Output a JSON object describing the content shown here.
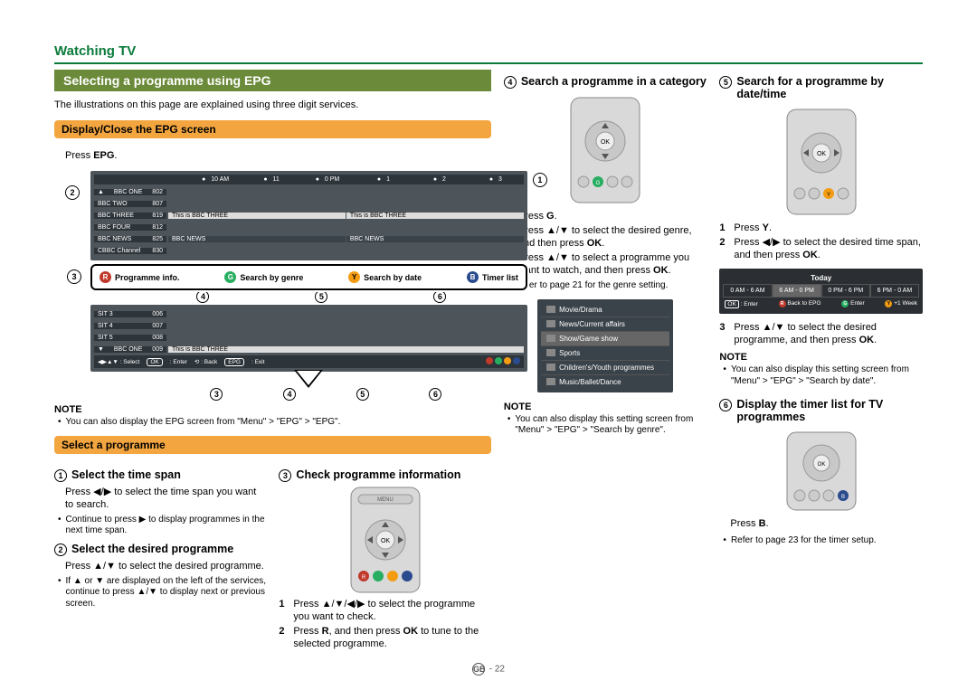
{
  "header": {
    "title": "Watching TV"
  },
  "main": {
    "section_title": "Selecting a programme using EPG",
    "intro": "The illustrations on this page are explained using three digit services."
  },
  "orange1": "Display/Close the EPG screen",
  "orange2": "Select a programme",
  "press_epg": "Press ",
  "press_epg_bold": "EPG",
  "note_label": "NOTE",
  "note_epg_menu": "You can also display the EPG screen from \"Menu\" > \"EPG\" > \"EPG\".",
  "epg": {
    "timeline": [
      "",
      "10 AM",
      "11",
      "0 PM",
      "1",
      "2",
      "3"
    ],
    "channels": [
      {
        "name": "BBC ONE",
        "num": "802",
        "prog": ""
      },
      {
        "name": "BBC TWO",
        "num": "807",
        "prog": ""
      },
      {
        "name": "BBC THREE",
        "num": "819",
        "prog1": "This is BBC THREE",
        "prog2": "This is BBC THREE"
      },
      {
        "name": "BBC FOUR",
        "num": "812",
        "prog": ""
      },
      {
        "name": "BBC NEWS",
        "num": "825",
        "prog1": "BBC NEWS",
        "prog2": "BBC NEWS"
      },
      {
        "name": "CBBC Channel",
        "num": "830",
        "prog": ""
      }
    ],
    "channels2": [
      {
        "name": "SIT 3",
        "num": "006"
      },
      {
        "name": "SIT 4",
        "num": "007"
      },
      {
        "name": "SIT 5",
        "num": "008"
      },
      {
        "name": "BBC ONE",
        "num": "009",
        "prog": "This is BBC THREE"
      }
    ],
    "footer": {
      "select": ": Select",
      "ok": "OK",
      "enter": ": Enter",
      "back": ": Back",
      "epg": "EPG",
      "exit": ": Exit"
    }
  },
  "colorbar": {
    "r": "Programme info.",
    "g": "Search by genre",
    "y": "Search by date",
    "b": "Timer list"
  },
  "step1": {
    "title": "Select the time span",
    "body": "Press ◀/▶ to select the time span you want to search.",
    "bullet": "Continue to press ▶ to display programmes in the next time span."
  },
  "step2": {
    "title": "Select the desired programme",
    "body": "Press ▲/▼ to select the desired programme.",
    "bullet": "If ▲ or ▼ are displayed on the left of the services, continue to press ▲/▼ to display next or previous screen."
  },
  "step3": {
    "title": "Check programme information",
    "li1": "Press ▲/▼/◀/▶ to select the programme you want to check.",
    "li2_a": "Press ",
    "li2_r": "R",
    "li2_b": ", and then press ",
    "li2_ok": "OK",
    "li2_c": " to tune to the selected programme."
  },
  "step4": {
    "title": "Search a programme in a category",
    "li1_a": "Press ",
    "li1_g": "G",
    "li1_b": ".",
    "li2_a": "Press ▲/▼ to select the desired genre, and then press ",
    "li2_ok": "OK",
    "li2_b": ".",
    "li3_a": "Press ▲/▼ to select a programme you want to watch, and then press ",
    "li3_ok": "OK",
    "li3_b": ".",
    "bullet": "Refer to page 21 for the genre setting.",
    "note": "You can also display this setting screen from \"Menu\" > \"EPG\" > \"Search by genre\"."
  },
  "genres": [
    "Movie/Drama",
    "News/Current affairs",
    "Show/Game show",
    "Sports",
    "Children's/Youth programmes",
    "Music/Ballet/Dance"
  ],
  "step5": {
    "title": "Search for a programme by date/time",
    "li1_a": "Press ",
    "li1_y": "Y",
    "li1_b": ".",
    "li2_a": "Press ◀/▶ to select the desired time span, and then press ",
    "li2_ok": "OK",
    "li2_b": ".",
    "li3_a": "Press ▲/▼ to select the desired programme, and then press ",
    "li3_ok": "OK",
    "li3_b": ".",
    "note": "You can also display this setting screen from \"Menu\" > \"EPG\" > \"Search by date\"."
  },
  "datestrip": {
    "title": "Today",
    "cells": [
      "0 AM - 6 AM",
      "6 AM - 0 PM",
      "0 PM - 6 PM",
      "6 PM - 0 AM"
    ],
    "foot": {
      "ok": "OK",
      "enter": ": Enter",
      "r": "R",
      "back": "Back to EPG",
      "g": "G",
      "enter2": "Enter",
      "y": "Y",
      "week": "+1 Week"
    }
  },
  "step6": {
    "title": "Display the timer list for TV programmes",
    "press_a": "Press ",
    "press_b": "B",
    "press_c": ".",
    "bullet": "Refer to page 23 for the timer setup."
  },
  "footer": {
    "region": "GB",
    "page": "22"
  }
}
